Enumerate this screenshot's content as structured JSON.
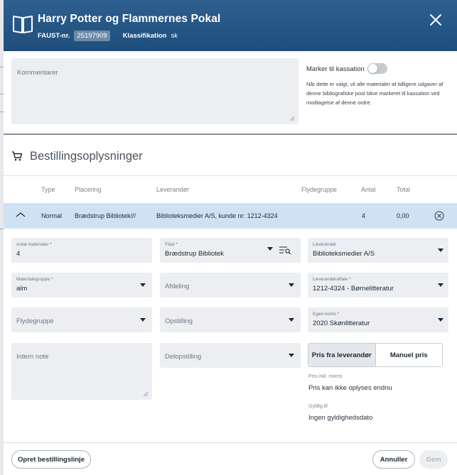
{
  "header": {
    "title": "Harry Potter og Flammernes Pokal",
    "faust_label": "FAUST-nr.",
    "faust_value": "25197909",
    "klass_label": "Klassifikation",
    "klass_value": "sk"
  },
  "comment": {
    "placeholder": "Kommentarer"
  },
  "kassation": {
    "label": "Marker til kassation",
    "enabled": false,
    "description": "Når dette er valgt, vil alle materialer af tidligere udgaver af denne bibliografiske post blive markeret til kassation ved modtagelse af denne ordre."
  },
  "section": {
    "title": "Bestillingsoplysninger"
  },
  "table": {
    "headers": [
      "Type",
      "Placering",
      "Leverandør",
      "Flydegruppe",
      "Antal",
      "Total"
    ],
    "row": {
      "type": "Normal",
      "placering": "Brædstrup Bibliotek///",
      "leverandor": "Biblioteksmedier A/S, kunde nr: 1212-4324",
      "flydegruppe": "",
      "antal": "4",
      "total": "0,00"
    }
  },
  "form": {
    "antal": {
      "label": "Antal materialer *",
      "value": "4"
    },
    "filial": {
      "label": "Filial *",
      "value": "Brædstrup Bibliotek"
    },
    "leverandor": {
      "label": "Leverandør",
      "value": "Biblioteksmedier A/S"
    },
    "materialegruppe": {
      "label": "Materialegruppe *",
      "value": "alm"
    },
    "afdeling": {
      "placeholder": "Afdeling"
    },
    "leverandoraftale": {
      "label": "Leverandøraftale *",
      "value": "1212-4324 - Børnelitteratur"
    },
    "flydegruppe": {
      "placeholder": "Flydegruppe"
    },
    "opstilling": {
      "placeholder": "Opstilling"
    },
    "egen_konto": {
      "label": "Egen konto *",
      "value": "2020 Skønlitteratur"
    },
    "intern_note": {
      "placeholder": "Intern note"
    },
    "delopstilling": {
      "placeholder": "Delopstilling"
    }
  },
  "pricing": {
    "option_supplier": "Pris fra leverandør",
    "option_manual": "Manuel pris",
    "price_label": "Pris inkl. moms",
    "price_value": "Pris kan ikke oplyses endnu",
    "valid_label": "Gyldig til",
    "valid_value": "Ingen gyldighedsdato"
  },
  "footer": {
    "create_line": "Opret bestillingslinje",
    "cancel": "Annuller",
    "save": "Gem"
  },
  "colors": {
    "header_bg": "#1f4e7c",
    "selected_row": "#cfe2f4",
    "field_bg": "#eceef1"
  }
}
